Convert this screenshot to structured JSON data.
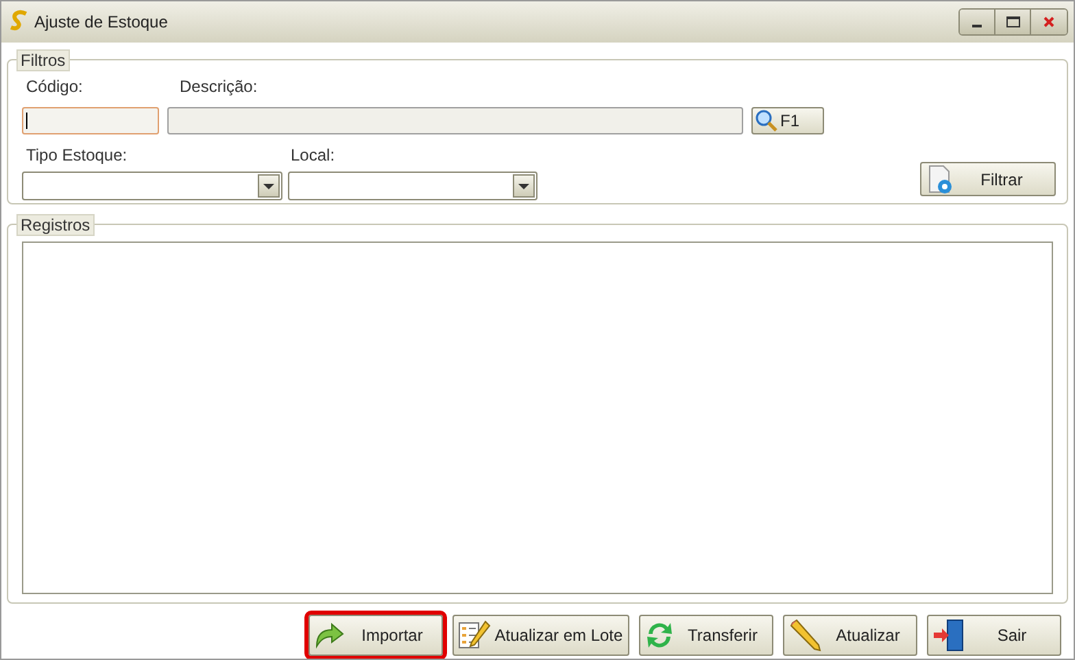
{
  "window": {
    "title": "Ajuste de Estoque"
  },
  "filters": {
    "legend": "Filtros",
    "codigo": {
      "label": "Código:",
      "focused": true
    },
    "descricao": {
      "label": "Descrição:"
    },
    "search_button": "F1",
    "tipo_estoque": {
      "label": "Tipo Estoque:"
    },
    "local": {
      "label": "Local:"
    },
    "filter_button": "Filtrar"
  },
  "records": {
    "legend": "Registros"
  },
  "buttons": [
    {
      "label": "Importar",
      "kind": "import",
      "highlighted": true
    },
    {
      "label": "Atualizar em Lote",
      "kind": "batch",
      "highlighted": false
    },
    {
      "label": "Transferir",
      "kind": "transfer",
      "highlighted": false
    },
    {
      "label": "Atualizar",
      "kind": "edit",
      "highlighted": false
    },
    {
      "label": "Sair",
      "kind": "exit",
      "highlighted": false
    }
  ]
}
